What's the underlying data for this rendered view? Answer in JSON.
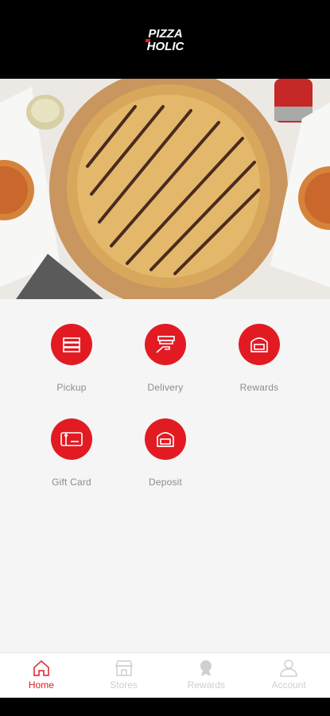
{
  "header": {
    "logo_line1": "PIZZA",
    "logo_line2": "HOLIC"
  },
  "actions": [
    {
      "label": "Pickup",
      "icon": "pizza-box-icon"
    },
    {
      "label": "Delivery",
      "icon": "delivery-hand-icon"
    },
    {
      "label": "Rewards",
      "icon": "oven-icon"
    },
    {
      "label": "Gift Card",
      "icon": "gift-card-icon"
    },
    {
      "label": "Deposit",
      "icon": "oven-icon"
    }
  ],
  "tabs": [
    {
      "label": "Home",
      "icon": "home-icon",
      "active": true
    },
    {
      "label": "Stores",
      "icon": "store-icon",
      "active": false
    },
    {
      "label": "Rewards",
      "icon": "rewards-icon",
      "active": false
    },
    {
      "label": "Account",
      "icon": "account-icon",
      "active": false
    }
  ],
  "colors": {
    "accent": "#e21b23",
    "header_bg": "#000000",
    "inactive": "#cfcfcf"
  }
}
